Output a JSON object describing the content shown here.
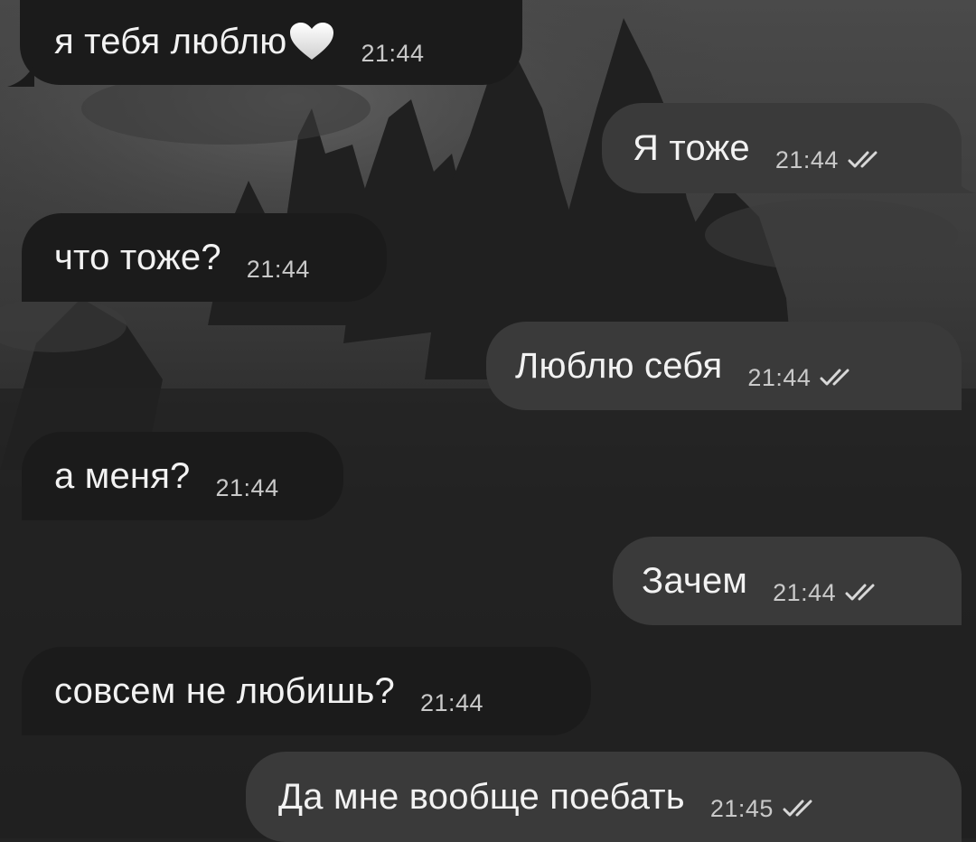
{
  "messages": [
    {
      "direction": "incoming",
      "text": "я тебя люблю",
      "emoji": "white-heart",
      "time": "21:44"
    },
    {
      "direction": "outgoing",
      "text": "Я тоже",
      "time": "21:44",
      "status": "read"
    },
    {
      "direction": "incoming",
      "text": "что тоже?",
      "time": "21:44"
    },
    {
      "direction": "outgoing",
      "text": "Люблю себя",
      "time": "21:44",
      "status": "read"
    },
    {
      "direction": "incoming",
      "text": "а меня?",
      "time": "21:44"
    },
    {
      "direction": "outgoing",
      "text": "Зачем",
      "time": "21:44",
      "status": "read"
    },
    {
      "direction": "incoming",
      "text": "совсем не любишь?",
      "time": "21:44"
    },
    {
      "direction": "outgoing",
      "text": "Да мне вообще поебать",
      "time": "21:45",
      "status": "read"
    }
  ],
  "colors": {
    "incoming_bubble": "#1b1b1b",
    "outgoing_bubble": "#3a3a3a",
    "text": "#f2f2f2",
    "time": "#c9c9c9"
  },
  "icons": {
    "read_status": "double-check-icon",
    "emoji": "white-heart-icon"
  }
}
